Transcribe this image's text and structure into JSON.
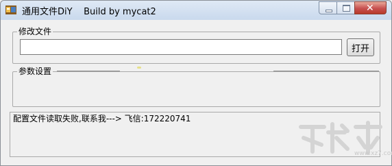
{
  "window": {
    "title": "通用文件DiY    Build by mycat2",
    "icon": "app-folder-icon",
    "controls": {
      "minimize": "minimize-icon",
      "maximize": "maximize-icon",
      "close": "close-icon"
    }
  },
  "file_group": {
    "legend": "修改文件",
    "input_value": "",
    "open_label": "打开"
  },
  "params_group": {
    "legend": "参数设置"
  },
  "status": {
    "message": "配置文件读取失败,联系我---> 飞信:172220741"
  },
  "watermark": {
    "text": "www.xz7.com"
  },
  "colors": {
    "titlebar": "#c9d9ed",
    "close_button": "#c75050",
    "window_bg": "#f0f0f0"
  }
}
